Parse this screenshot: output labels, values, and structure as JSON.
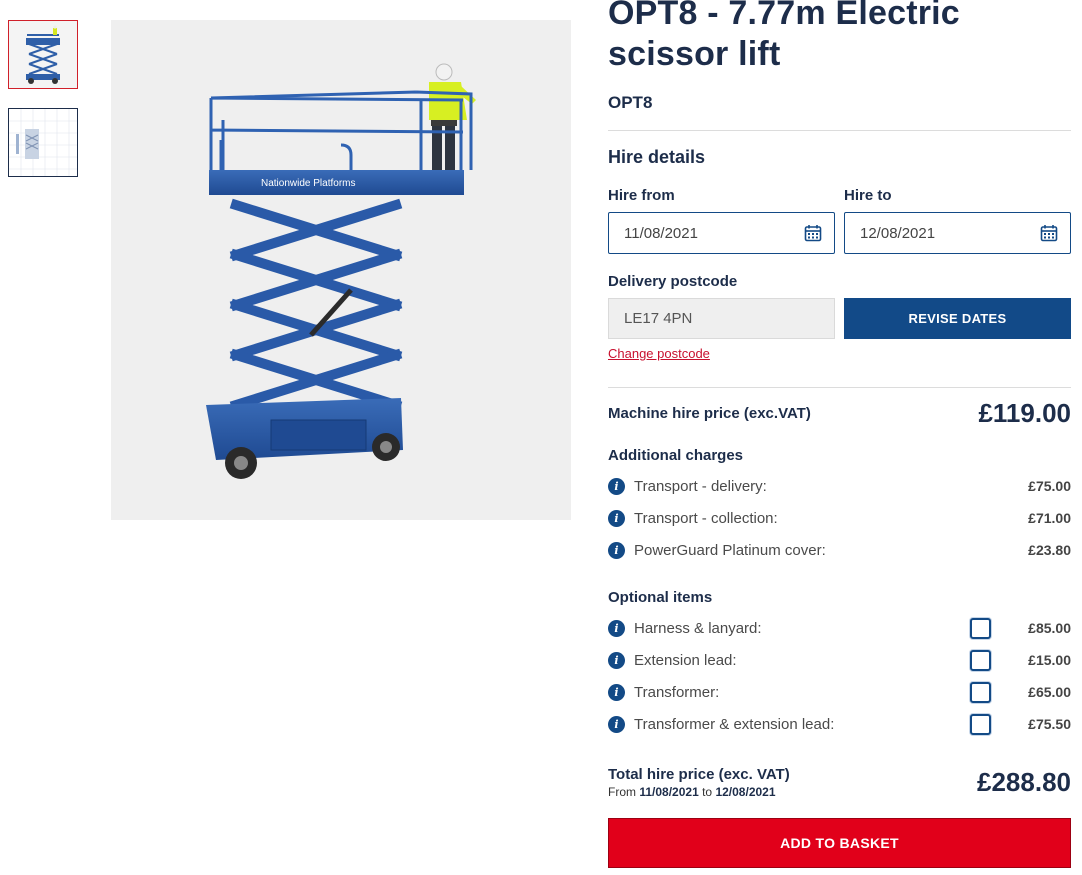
{
  "product": {
    "title": "OPT8 - 7.77m Electric scissor lift",
    "sku": "OPT8",
    "image_brand_text": "Nationwide Platforms"
  },
  "hire": {
    "title": "Hire details",
    "from_label": "Hire from",
    "from_value": "11/08/2021",
    "to_label": "Hire to",
    "to_value": "12/08/2021",
    "postcode_label": "Delivery postcode",
    "postcode_value": "LE17 4PN",
    "revise_button": "REVISE DATES",
    "change_postcode": "Change postcode"
  },
  "machine": {
    "label": "Machine hire price (exc.VAT)",
    "price": "£119.00"
  },
  "additional": {
    "title": "Additional charges",
    "items": [
      {
        "label": "Transport - delivery:",
        "price": "£75.00"
      },
      {
        "label": "Transport - collection:",
        "price": "£71.00"
      },
      {
        "label": "PowerGuard Platinum cover:",
        "price": "£23.80"
      }
    ]
  },
  "optional": {
    "title": "Optional items",
    "items": [
      {
        "label": "Harness & lanyard:",
        "price": "£85.00",
        "checked": false
      },
      {
        "label": "Extension lead:",
        "price": "£15.00",
        "checked": false
      },
      {
        "label": "Transformer:",
        "price": "£65.00",
        "checked": false
      },
      {
        "label": "Transformer & extension lead:",
        "price": "£75.50",
        "checked": false
      }
    ]
  },
  "total": {
    "label": "Total hire price (exc. VAT)",
    "from_word": "From",
    "from_date": "11/08/2021",
    "to_word": "to",
    "to_date": "12/08/2021",
    "price": "£288.80"
  },
  "basket_button": "ADD TO BASKET",
  "icons": {
    "info": "info-icon",
    "calendar": "calendar-icon"
  },
  "colors": {
    "navy": "#1d2d4a",
    "brand_blue": "#124a88",
    "basket_red": "#e1001a",
    "link_red": "#c8102e"
  }
}
